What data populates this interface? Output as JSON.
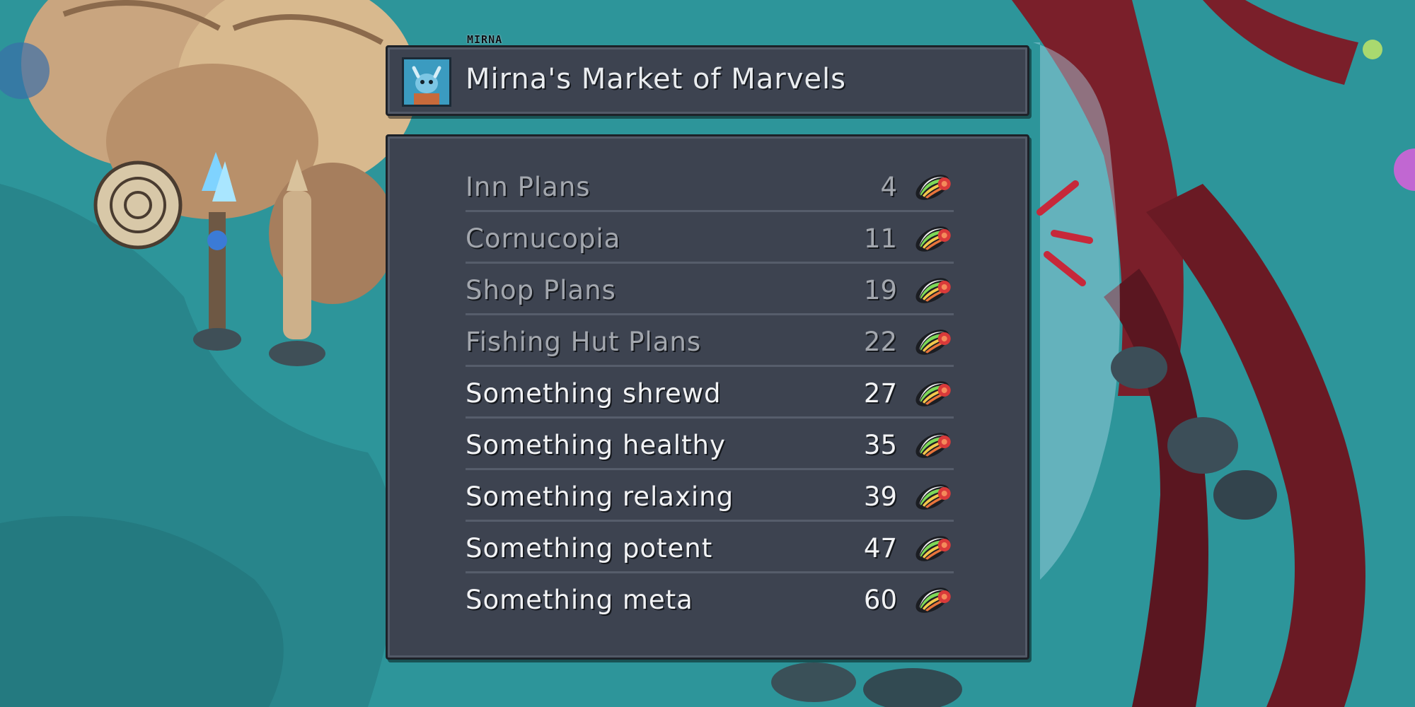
{
  "npc": {
    "tag": "MIRNA"
  },
  "shop": {
    "title": "Mirna's Market of Marvels",
    "portrait_icon": "lobster-creature-portrait-icon",
    "currency_icon": "rainbow-shell-icon"
  },
  "items": [
    {
      "name": "Inn Plans",
      "price": "4",
      "available": false
    },
    {
      "name": "Cornucopia",
      "price": "11",
      "available": false
    },
    {
      "name": "Shop Plans",
      "price": "19",
      "available": false
    },
    {
      "name": "Fishing Hut Plans",
      "price": "22",
      "available": false
    },
    {
      "name": "Something shrewd",
      "price": "27",
      "available": true
    },
    {
      "name": "Something healthy",
      "price": "35",
      "available": true
    },
    {
      "name": "Something relaxing",
      "price": "39",
      "available": true
    },
    {
      "name": "Something potent",
      "price": "47",
      "available": true
    },
    {
      "name": "Something meta",
      "price": "60",
      "available": true
    }
  ],
  "colors": {
    "panel": "#3d4350",
    "available_text": "#f2f3f5",
    "unavailable_text": "#a3a7ae"
  }
}
